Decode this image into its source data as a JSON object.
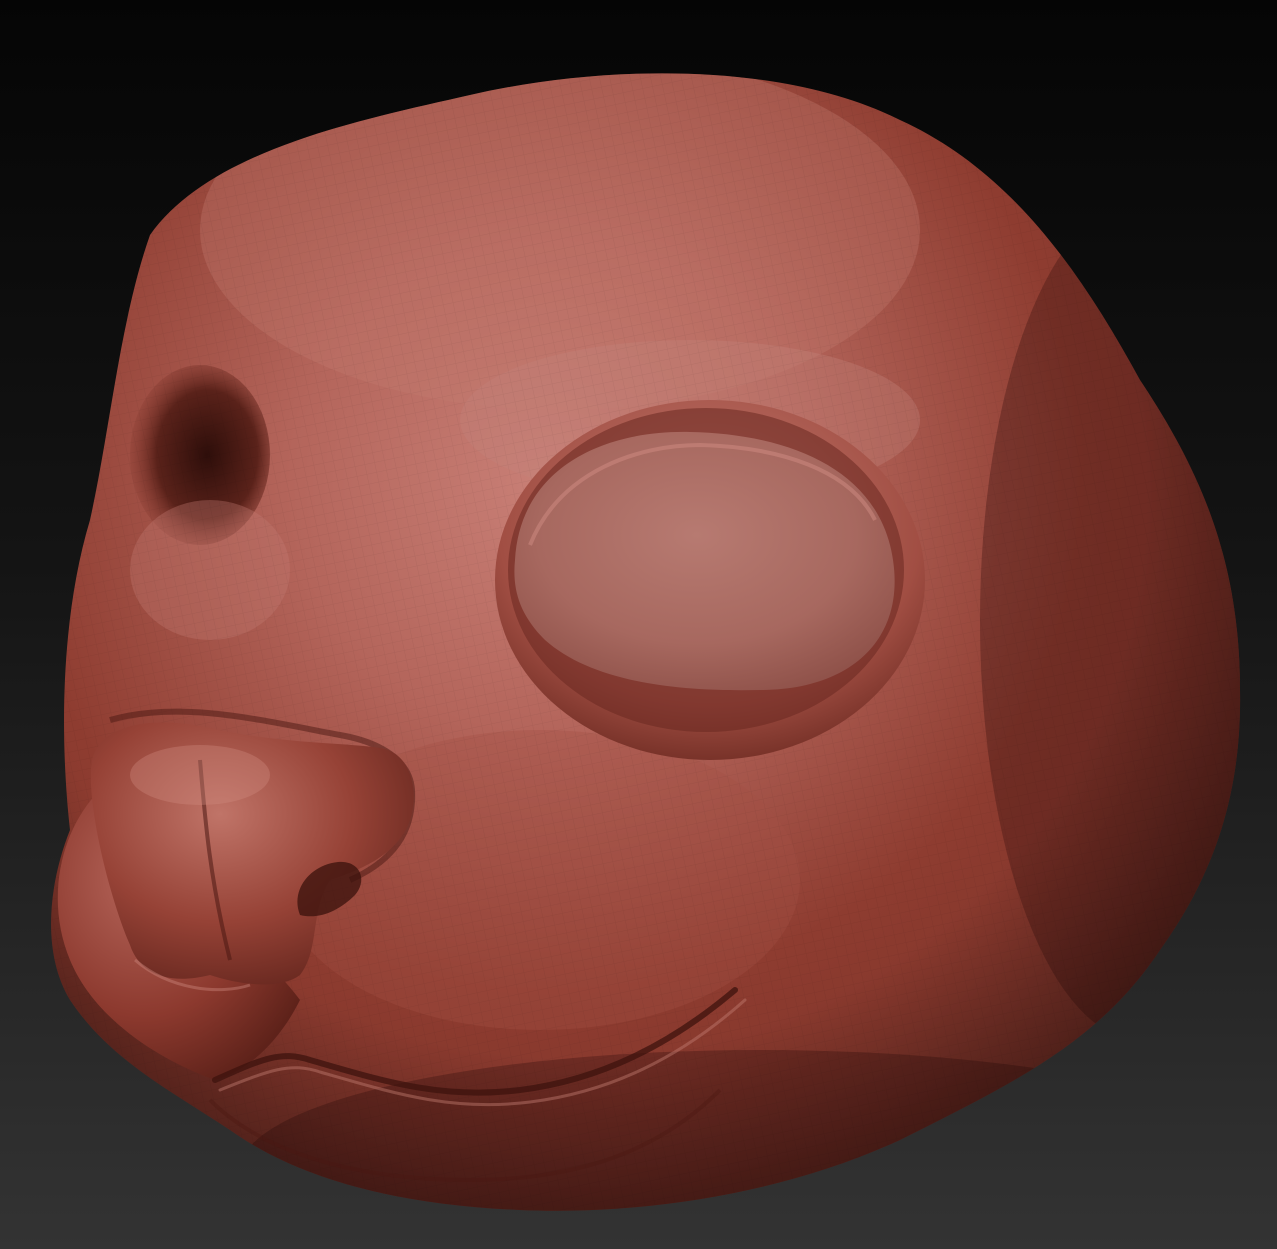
{
  "scene": {
    "subject": "sculpted-animal-head",
    "colors": {
      "background_top": "#050505",
      "background_bottom": "#333333",
      "clay_base": "#8e3c30",
      "clay_light": "#b4655b",
      "clay_highlight": "#c98077",
      "clay_mid": "#7c3228",
      "clay_shadow": "#4f1d16",
      "clay_deep_shadow": "#2e0e0a",
      "eye_socket": "#a7685f"
    }
  }
}
